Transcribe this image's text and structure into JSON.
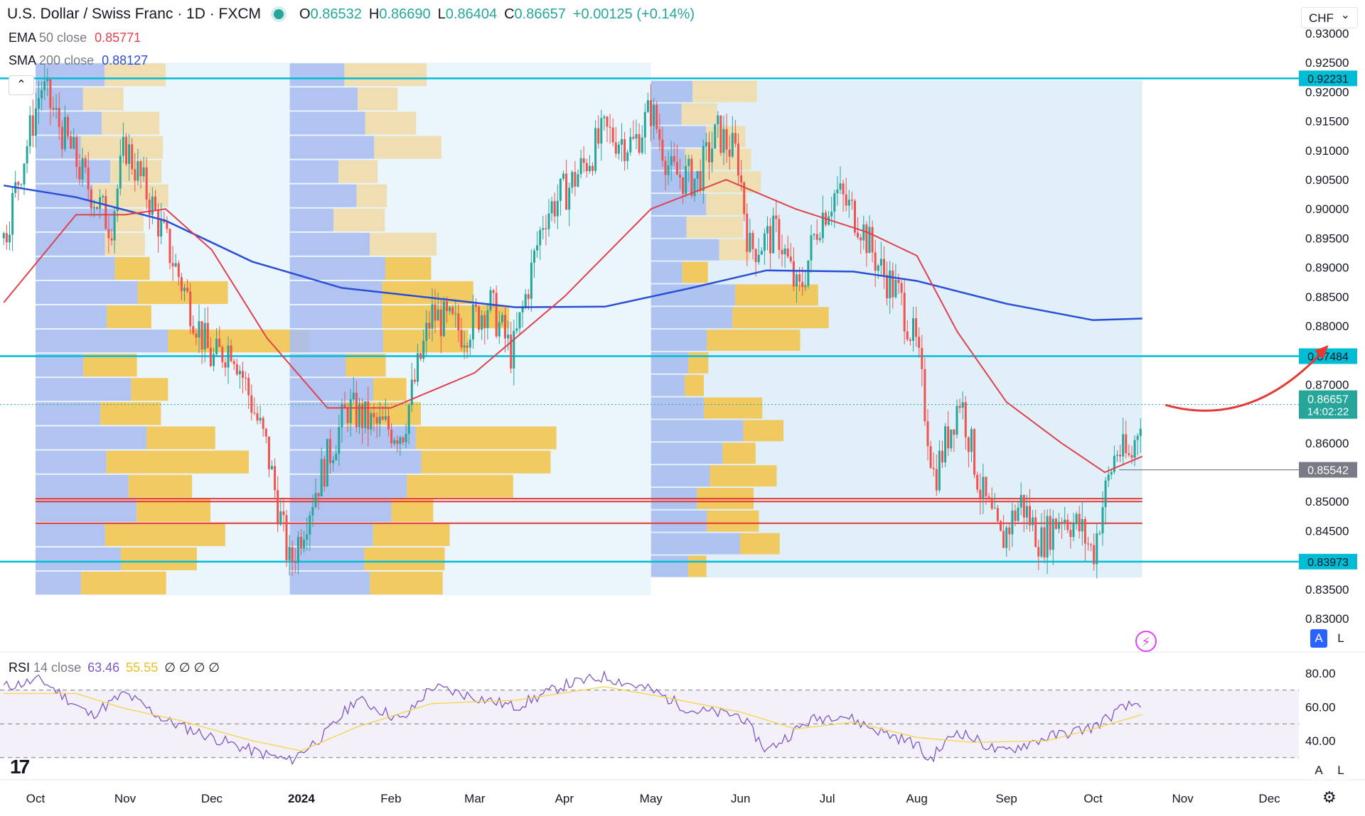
{
  "header": {
    "symbol": "U.S. Dollar / Swiss Franc · 1D · FXCM",
    "open_k": "O",
    "open": "0.86532",
    "high_k": "H",
    "high": "0.86690",
    "low_k": "L",
    "low": "0.86404",
    "close_k": "C",
    "close": "0.86657",
    "change": "+0.00125 (+0.14%)"
  },
  "indicators": {
    "ema_name": "EMA",
    "ema_params": "50 close",
    "ema_value": "0.85771",
    "sma_name": "SMA",
    "sma_params": "200 close",
    "sma_value": "0.88127"
  },
  "currency": "CHF",
  "collapse_icon": "chevron-up-icon",
  "scale_buttons": {
    "a": "A",
    "l": "L"
  },
  "rsi_label": {
    "name": "RSI",
    "params": "14 close",
    "value": "63.46",
    "ma": "55.55",
    "extra": "∅ ∅ ∅ ∅"
  },
  "colors": {
    "up": "#26a69a",
    "down": "#ef5350",
    "ema": "#e0414f",
    "sma": "#2a4fd6",
    "level": "#00bcd4",
    "rsi": "#7e57c2",
    "rsi_ma": "#f5d547",
    "arrow": "#e53935"
  },
  "chart_data": {
    "type": "candlestick",
    "symbol": "USD/CHF",
    "ylim": [
      0.828,
      0.932
    ],
    "y_ticks": [
      "0.93000",
      "0.92500",
      "0.92000",
      "0.91500",
      "0.91000",
      "0.90500",
      "0.90000",
      "0.89500",
      "0.89000",
      "0.88500",
      "0.88000",
      "0.87000",
      "0.86000",
      "0.85000",
      "0.84500",
      "0.83500",
      "0.83000"
    ],
    "y_tick_values": [
      0.93,
      0.925,
      0.92,
      0.915,
      0.91,
      0.905,
      0.9,
      0.895,
      0.89,
      0.885,
      0.88,
      0.87,
      0.86,
      0.85,
      0.845,
      0.835,
      0.83
    ],
    "x_ticks": [
      "Oct",
      "Nov",
      "Dec",
      "2024",
      "Feb",
      "Mar",
      "Apr",
      "May",
      "Jun",
      "Jul",
      "Aug",
      "Sep",
      "Oct",
      "Nov",
      "Dec"
    ],
    "x_tick_dates": [
      "2023-10-01",
      "2023-11-01",
      "2023-12-01",
      "2024-01-01",
      "2024-02-01",
      "2024-03-01",
      "2024-04-01",
      "2024-05-01",
      "2024-06-01",
      "2024-07-01",
      "2024-08-01",
      "2024-09-01",
      "2024-10-01",
      "2024-11-01",
      "2024-12-01"
    ],
    "horizontal_levels": [
      {
        "label": "0.92231",
        "value": 0.92231,
        "color": "#00bcd4"
      },
      {
        "label": "0.87484",
        "value": 0.87484,
        "color": "#00bcd4"
      },
      {
        "label": "0.83973",
        "value": 0.83973,
        "color": "#00bcd4"
      }
    ],
    "red_levels": [
      0.8505,
      0.85,
      0.8463
    ],
    "last_price": {
      "label": "0.86657",
      "countdown": "14:02:22",
      "value": 0.86657
    },
    "prev_close": {
      "label": "0.85542",
      "value": 0.85542
    },
    "price_path": [
      {
        "date": "2023-09-20",
        "value": 0.895
      },
      {
        "date": "2023-10-03",
        "value": 0.921
      },
      {
        "date": "2023-10-18",
        "value": 0.905
      },
      {
        "date": "2023-10-27",
        "value": 0.897
      },
      {
        "date": "2023-11-01",
        "value": 0.911
      },
      {
        "date": "2023-11-10",
        "value": 0.901
      },
      {
        "date": "2023-11-20",
        "value": 0.888
      },
      {
        "date": "2023-12-01",
        "value": 0.874
      },
      {
        "date": "2023-12-08",
        "value": 0.877
      },
      {
        "date": "2023-12-20",
        "value": 0.859
      },
      {
        "date": "2023-12-28",
        "value": 0.839
      },
      {
        "date": "2024-01-05",
        "value": 0.851
      },
      {
        "date": "2024-01-17",
        "value": 0.866
      },
      {
        "date": "2024-01-26",
        "value": 0.863
      },
      {
        "date": "2024-02-05",
        "value": 0.862
      },
      {
        "date": "2024-02-15",
        "value": 0.882
      },
      {
        "date": "2024-02-26",
        "value": 0.879
      },
      {
        "date": "2024-03-06",
        "value": 0.884
      },
      {
        "date": "2024-03-14",
        "value": 0.875
      },
      {
        "date": "2024-03-25",
        "value": 0.899
      },
      {
        "date": "2024-04-03",
        "value": 0.904
      },
      {
        "date": "2024-04-15",
        "value": 0.913
      },
      {
        "date": "2024-04-25",
        "value": 0.911
      },
      {
        "date": "2024-05-01",
        "value": 0.917
      },
      {
        "date": "2024-05-08",
        "value": 0.906
      },
      {
        "date": "2024-05-17",
        "value": 0.905
      },
      {
        "date": "2024-05-24",
        "value": 0.913
      },
      {
        "date": "2024-05-31",
        "value": 0.909
      },
      {
        "date": "2024-06-04",
        "value": 0.893
      },
      {
        "date": "2024-06-14",
        "value": 0.896
      },
      {
        "date": "2024-06-21",
        "value": 0.885
      },
      {
        "date": "2024-06-28",
        "value": 0.898
      },
      {
        "date": "2024-07-04",
        "value": 0.903
      },
      {
        "date": "2024-07-12",
        "value": 0.898
      },
      {
        "date": "2024-07-19",
        "value": 0.89
      },
      {
        "date": "2024-07-26",
        "value": 0.885
      },
      {
        "date": "2024-08-01",
        "value": 0.876
      },
      {
        "date": "2024-08-07",
        "value": 0.854
      },
      {
        "date": "2024-08-16",
        "value": 0.868
      },
      {
        "date": "2024-08-23",
        "value": 0.852
      },
      {
        "date": "2024-08-30",
        "value": 0.843
      },
      {
        "date": "2024-09-06",
        "value": 0.85
      },
      {
        "date": "2024-09-13",
        "value": 0.843
      },
      {
        "date": "2024-09-20",
        "value": 0.848
      },
      {
        "date": "2024-09-27",
        "value": 0.845
      },
      {
        "date": "2024-10-01",
        "value": 0.841
      },
      {
        "date": "2024-10-04",
        "value": 0.849
      },
      {
        "date": "2024-10-09",
        "value": 0.859
      },
      {
        "date": "2024-10-14",
        "value": 0.857
      },
      {
        "date": "2024-10-18",
        "value": 0.86657
      }
    ],
    "ema50": [
      {
        "date": "2023-09-20",
        "value": 0.884
      },
      {
        "date": "2023-10-15",
        "value": 0.899
      },
      {
        "date": "2023-11-01",
        "value": 0.899
      },
      {
        "date": "2023-11-15",
        "value": 0.9
      },
      {
        "date": "2023-12-01",
        "value": 0.893
      },
      {
        "date": "2023-12-20",
        "value": 0.878
      },
      {
        "date": "2024-01-10",
        "value": 0.866
      },
      {
        "date": "2024-02-01",
        "value": 0.866
      },
      {
        "date": "2024-03-01",
        "value": 0.872
      },
      {
        "date": "2024-04-01",
        "value": 0.885
      },
      {
        "date": "2024-05-01",
        "value": 0.9
      },
      {
        "date": "2024-05-27",
        "value": 0.905
      },
      {
        "date": "2024-06-20",
        "value": 0.9
      },
      {
        "date": "2024-07-15",
        "value": 0.896
      },
      {
        "date": "2024-08-01",
        "value": 0.892
      },
      {
        "date": "2024-08-15",
        "value": 0.879
      },
      {
        "date": "2024-09-01",
        "value": 0.867
      },
      {
        "date": "2024-09-20",
        "value": 0.86
      },
      {
        "date": "2024-10-05",
        "value": 0.855
      },
      {
        "date": "2024-10-18",
        "value": 0.85771
      }
    ],
    "sma200": [
      {
        "date": "2023-09-20",
        "value": 0.904
      },
      {
        "date": "2023-10-15",
        "value": 0.902
      },
      {
        "date": "2023-11-15",
        "value": 0.898
      },
      {
        "date": "2023-12-15",
        "value": 0.891
      },
      {
        "date": "2024-01-15",
        "value": 0.8865
      },
      {
        "date": "2024-02-15",
        "value": 0.8848
      },
      {
        "date": "2024-03-15",
        "value": 0.8832
      },
      {
        "date": "2024-04-15",
        "value": 0.8833
      },
      {
        "date": "2024-05-15",
        "value": 0.8865
      },
      {
        "date": "2024-06-10",
        "value": 0.8895
      },
      {
        "date": "2024-07-10",
        "value": 0.8893
      },
      {
        "date": "2024-08-01",
        "value": 0.8877
      },
      {
        "date": "2024-09-01",
        "value": 0.8838
      },
      {
        "date": "2024-10-01",
        "value": 0.881
      },
      {
        "date": "2024-10-18",
        "value": 0.88127
      }
    ],
    "volume_profiles": [
      {
        "start": "2023-10-01",
        "end": "2023-12-28",
        "high": 0.925,
        "low": 0.834
      },
      {
        "start": "2023-12-28",
        "end": "2024-05-01",
        "high": 0.925,
        "low": 0.834
      },
      {
        "start": "2024-05-01",
        "end": "2024-10-18",
        "high": 0.922,
        "low": 0.837
      }
    ],
    "projection_arrow": {
      "from": {
        "date": "2024-10-26",
        "value": 0.8665
      },
      "to": {
        "date": "2024-12-21",
        "value": 0.8765
      }
    },
    "rsi": {
      "ylim": [
        25,
        90
      ],
      "y_ticks": [
        "80.00",
        "60.00",
        "40.00"
      ],
      "y_tick_values": [
        80,
        60,
        40
      ],
      "bands": [
        70,
        50,
        30
      ],
      "values": [
        {
          "date": "2023-09-20",
          "value": 72
        },
        {
          "date": "2023-10-03",
          "value": 76
        },
        {
          "date": "2023-10-20",
          "value": 55
        },
        {
          "date": "2023-11-01",
          "value": 68
        },
        {
          "date": "2023-11-15",
          "value": 52
        },
        {
          "date": "2023-12-01",
          "value": 42
        },
        {
          "date": "2023-12-15",
          "value": 34
        },
        {
          "date": "2023-12-28",
          "value": 28
        },
        {
          "date": "2024-01-10",
          "value": 45
        },
        {
          "date": "2024-01-20",
          "value": 65
        },
        {
          "date": "2024-02-05",
          "value": 52
        },
        {
          "date": "2024-02-15",
          "value": 72
        },
        {
          "date": "2024-03-01",
          "value": 66
        },
        {
          "date": "2024-03-15",
          "value": 60
        },
        {
          "date": "2024-04-01",
          "value": 73
        },
        {
          "date": "2024-04-15",
          "value": 78
        },
        {
          "date": "2024-05-01",
          "value": 70
        },
        {
          "date": "2024-05-15",
          "value": 58
        },
        {
          "date": "2024-06-01",
          "value": 55
        },
        {
          "date": "2024-06-10",
          "value": 34
        },
        {
          "date": "2024-06-25",
          "value": 52
        },
        {
          "date": "2024-07-05",
          "value": 56
        },
        {
          "date": "2024-07-20",
          "value": 45
        },
        {
          "date": "2024-08-01",
          "value": 38
        },
        {
          "date": "2024-08-05",
          "value": 28
        },
        {
          "date": "2024-08-15",
          "value": 46
        },
        {
          "date": "2024-08-30",
          "value": 33
        },
        {
          "date": "2024-09-15",
          "value": 42
        },
        {
          "date": "2024-10-01",
          "value": 48
        },
        {
          "date": "2024-10-10",
          "value": 58
        },
        {
          "date": "2024-10-18",
          "value": 63.46
        }
      ],
      "ma": [
        {
          "date": "2023-09-20",
          "value": 68
        },
        {
          "date": "2023-10-15",
          "value": 68
        },
        {
          "date": "2023-11-01",
          "value": 59
        },
        {
          "date": "2023-11-20",
          "value": 52
        },
        {
          "date": "2023-12-15",
          "value": 40
        },
        {
          "date": "2024-01-01",
          "value": 34
        },
        {
          "date": "2024-01-20",
          "value": 48
        },
        {
          "date": "2024-02-15",
          "value": 62
        },
        {
          "date": "2024-03-15",
          "value": 64
        },
        {
          "date": "2024-04-15",
          "value": 72
        },
        {
          "date": "2024-05-05",
          "value": 66
        },
        {
          "date": "2024-06-01",
          "value": 57
        },
        {
          "date": "2024-06-20",
          "value": 47
        },
        {
          "date": "2024-07-10",
          "value": 51
        },
        {
          "date": "2024-08-01",
          "value": 42
        },
        {
          "date": "2024-08-20",
          "value": 39
        },
        {
          "date": "2024-09-15",
          "value": 40
        },
        {
          "date": "2024-10-01",
          "value": 47
        },
        {
          "date": "2024-10-18",
          "value": 55.55
        }
      ]
    }
  }
}
